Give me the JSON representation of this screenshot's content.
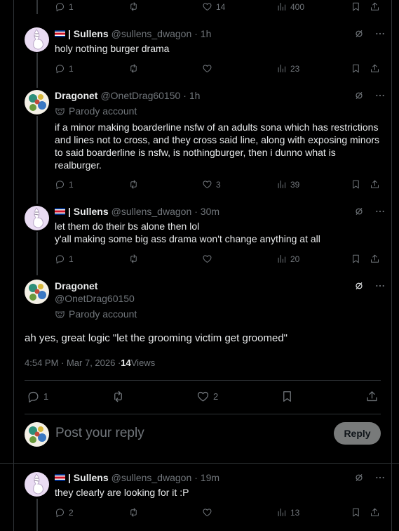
{
  "top_actions": {
    "replies": "1",
    "likes": "14",
    "views": "400"
  },
  "reply1": {
    "display_name": "| Sullens",
    "handle": "@sullens_dwagon",
    "time": "· 1h",
    "text": "holy nothing burger drama",
    "replies": "1",
    "views": "23"
  },
  "reply2": {
    "display_name": "Dragonet",
    "handle": "@OnetDrag60150",
    "time": "· 1h",
    "parody": "Parody account",
    "text": "if a minor making boarderline nsfw of an adults sona which has restrictions and lines not to cross, and they cross said line, along with exposing minors to said boarderline is nsfw, is nothingburger, then i dunno what is realburger.",
    "replies": "1",
    "likes": "3",
    "views": "39"
  },
  "reply3": {
    "display_name": "| Sullens",
    "handle": "@sullens_dwagon",
    "time": "· 30m",
    "line1": "let them do their bs alone then lol",
    "line2": "y'all making some big ass drama won't change anything at all",
    "replies": "1",
    "views": "20"
  },
  "main": {
    "display_name": "Dragonet",
    "handle": "@OnetDrag60150",
    "parody": "Parody account",
    "text": "ah yes, great logic \"let the grooming victim get groomed\"",
    "timestamp": "4:54 PM · Mar 7, 2026 · ",
    "views_count": "14",
    "views_label": " Views",
    "replies": "1",
    "likes": "2"
  },
  "composer": {
    "placeholder": "Post your reply",
    "button": "Reply"
  },
  "reply4": {
    "display_name": "| Sullens",
    "handle": "@sullens_dwagon",
    "time": "· 19m",
    "text": "they clearly are looking for it :P",
    "replies": "2",
    "views": "13"
  },
  "colors": {
    "background": "#000000",
    "text": "#e7e9ea",
    "muted": "#71767b",
    "border": "#2f3336"
  }
}
